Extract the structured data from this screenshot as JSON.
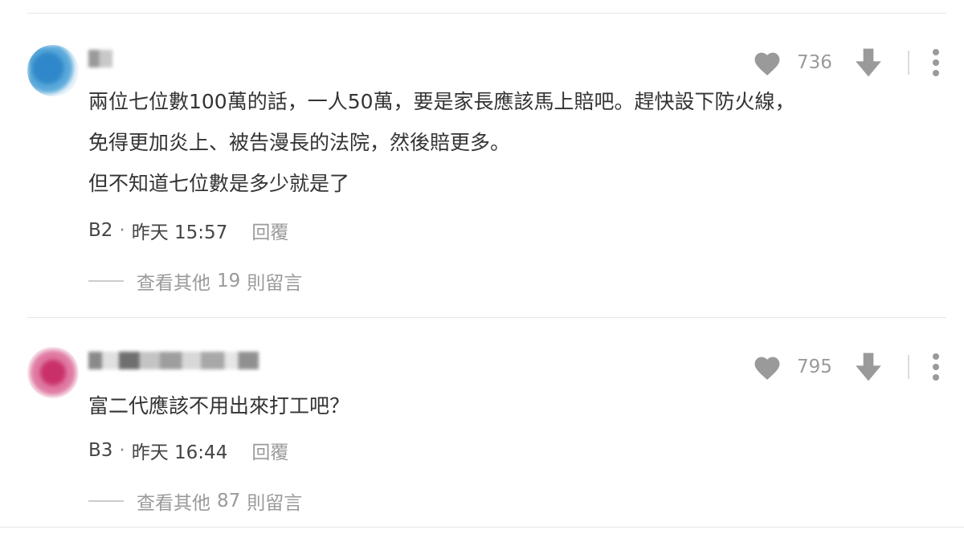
{
  "comments": [
    {
      "author": "",
      "likes": "736",
      "lines": [
        "兩位七位數100萬的話，一人50萬，要是家長應該馬上賠吧。趕快設下防火線，",
        "免得更加炎上、被告漫長的法院，然後賠更多。",
        "但不知道七位數是多少就是了"
      ],
      "floor": "B2",
      "time": "昨天 15:57",
      "reply_label": "回覆",
      "more_prefix": "查看其他",
      "more_count": "19",
      "more_suffix": "則留言",
      "avatar_color": "#3d8fc4"
    },
    {
      "author": "",
      "likes": "795",
      "lines": [
        "富二代應該不用出來打工吧？"
      ],
      "floor": "B3",
      "time": "昨天 16:44",
      "reply_label": "回覆",
      "more_prefix": "查看其他",
      "more_count": "87",
      "more_suffix": "則留言",
      "avatar_color": "#d24a7e"
    }
  ],
  "icons": {
    "like": "heart-icon",
    "dislike": "arrow-down-icon",
    "more": "more-vertical-icon"
  },
  "colors": {
    "icon_gray": "#9a9a9a",
    "text": "#333333",
    "divider": "#e6e6e6"
  }
}
